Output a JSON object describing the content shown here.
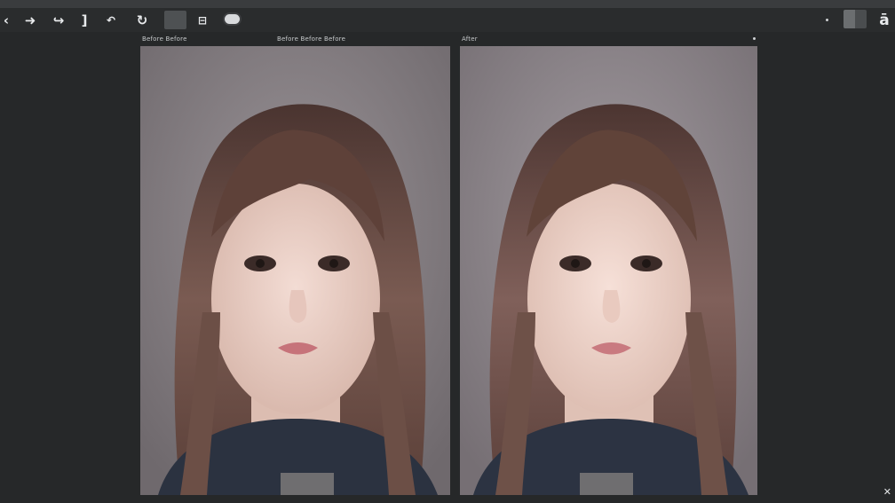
{
  "toolbar": {
    "icons": [
      {
        "name": "back-icon",
        "glyph": "‹"
      },
      {
        "name": "redo-arrow-icon",
        "glyph": "➜"
      },
      {
        "name": "forward-arrow-icon",
        "glyph": "↪"
      },
      {
        "name": "bracket-icon",
        "glyph": "]"
      },
      {
        "name": "lasso-icon",
        "glyph": "↶"
      },
      {
        "name": "rotate-icon",
        "glyph": "↻"
      },
      {
        "name": "layers-icon",
        "glyph": "⊟"
      },
      {
        "name": "app-icon",
        "glyph": "ā"
      }
    ]
  },
  "panels": {
    "left": {
      "label_a": "Before Before",
      "label_b": "Before Before Before"
    },
    "right": {
      "label": "After"
    }
  },
  "colors": {
    "background": "#262829",
    "toolbar": "#2a2c2d",
    "portrait_backdrop": "#8c8589"
  }
}
